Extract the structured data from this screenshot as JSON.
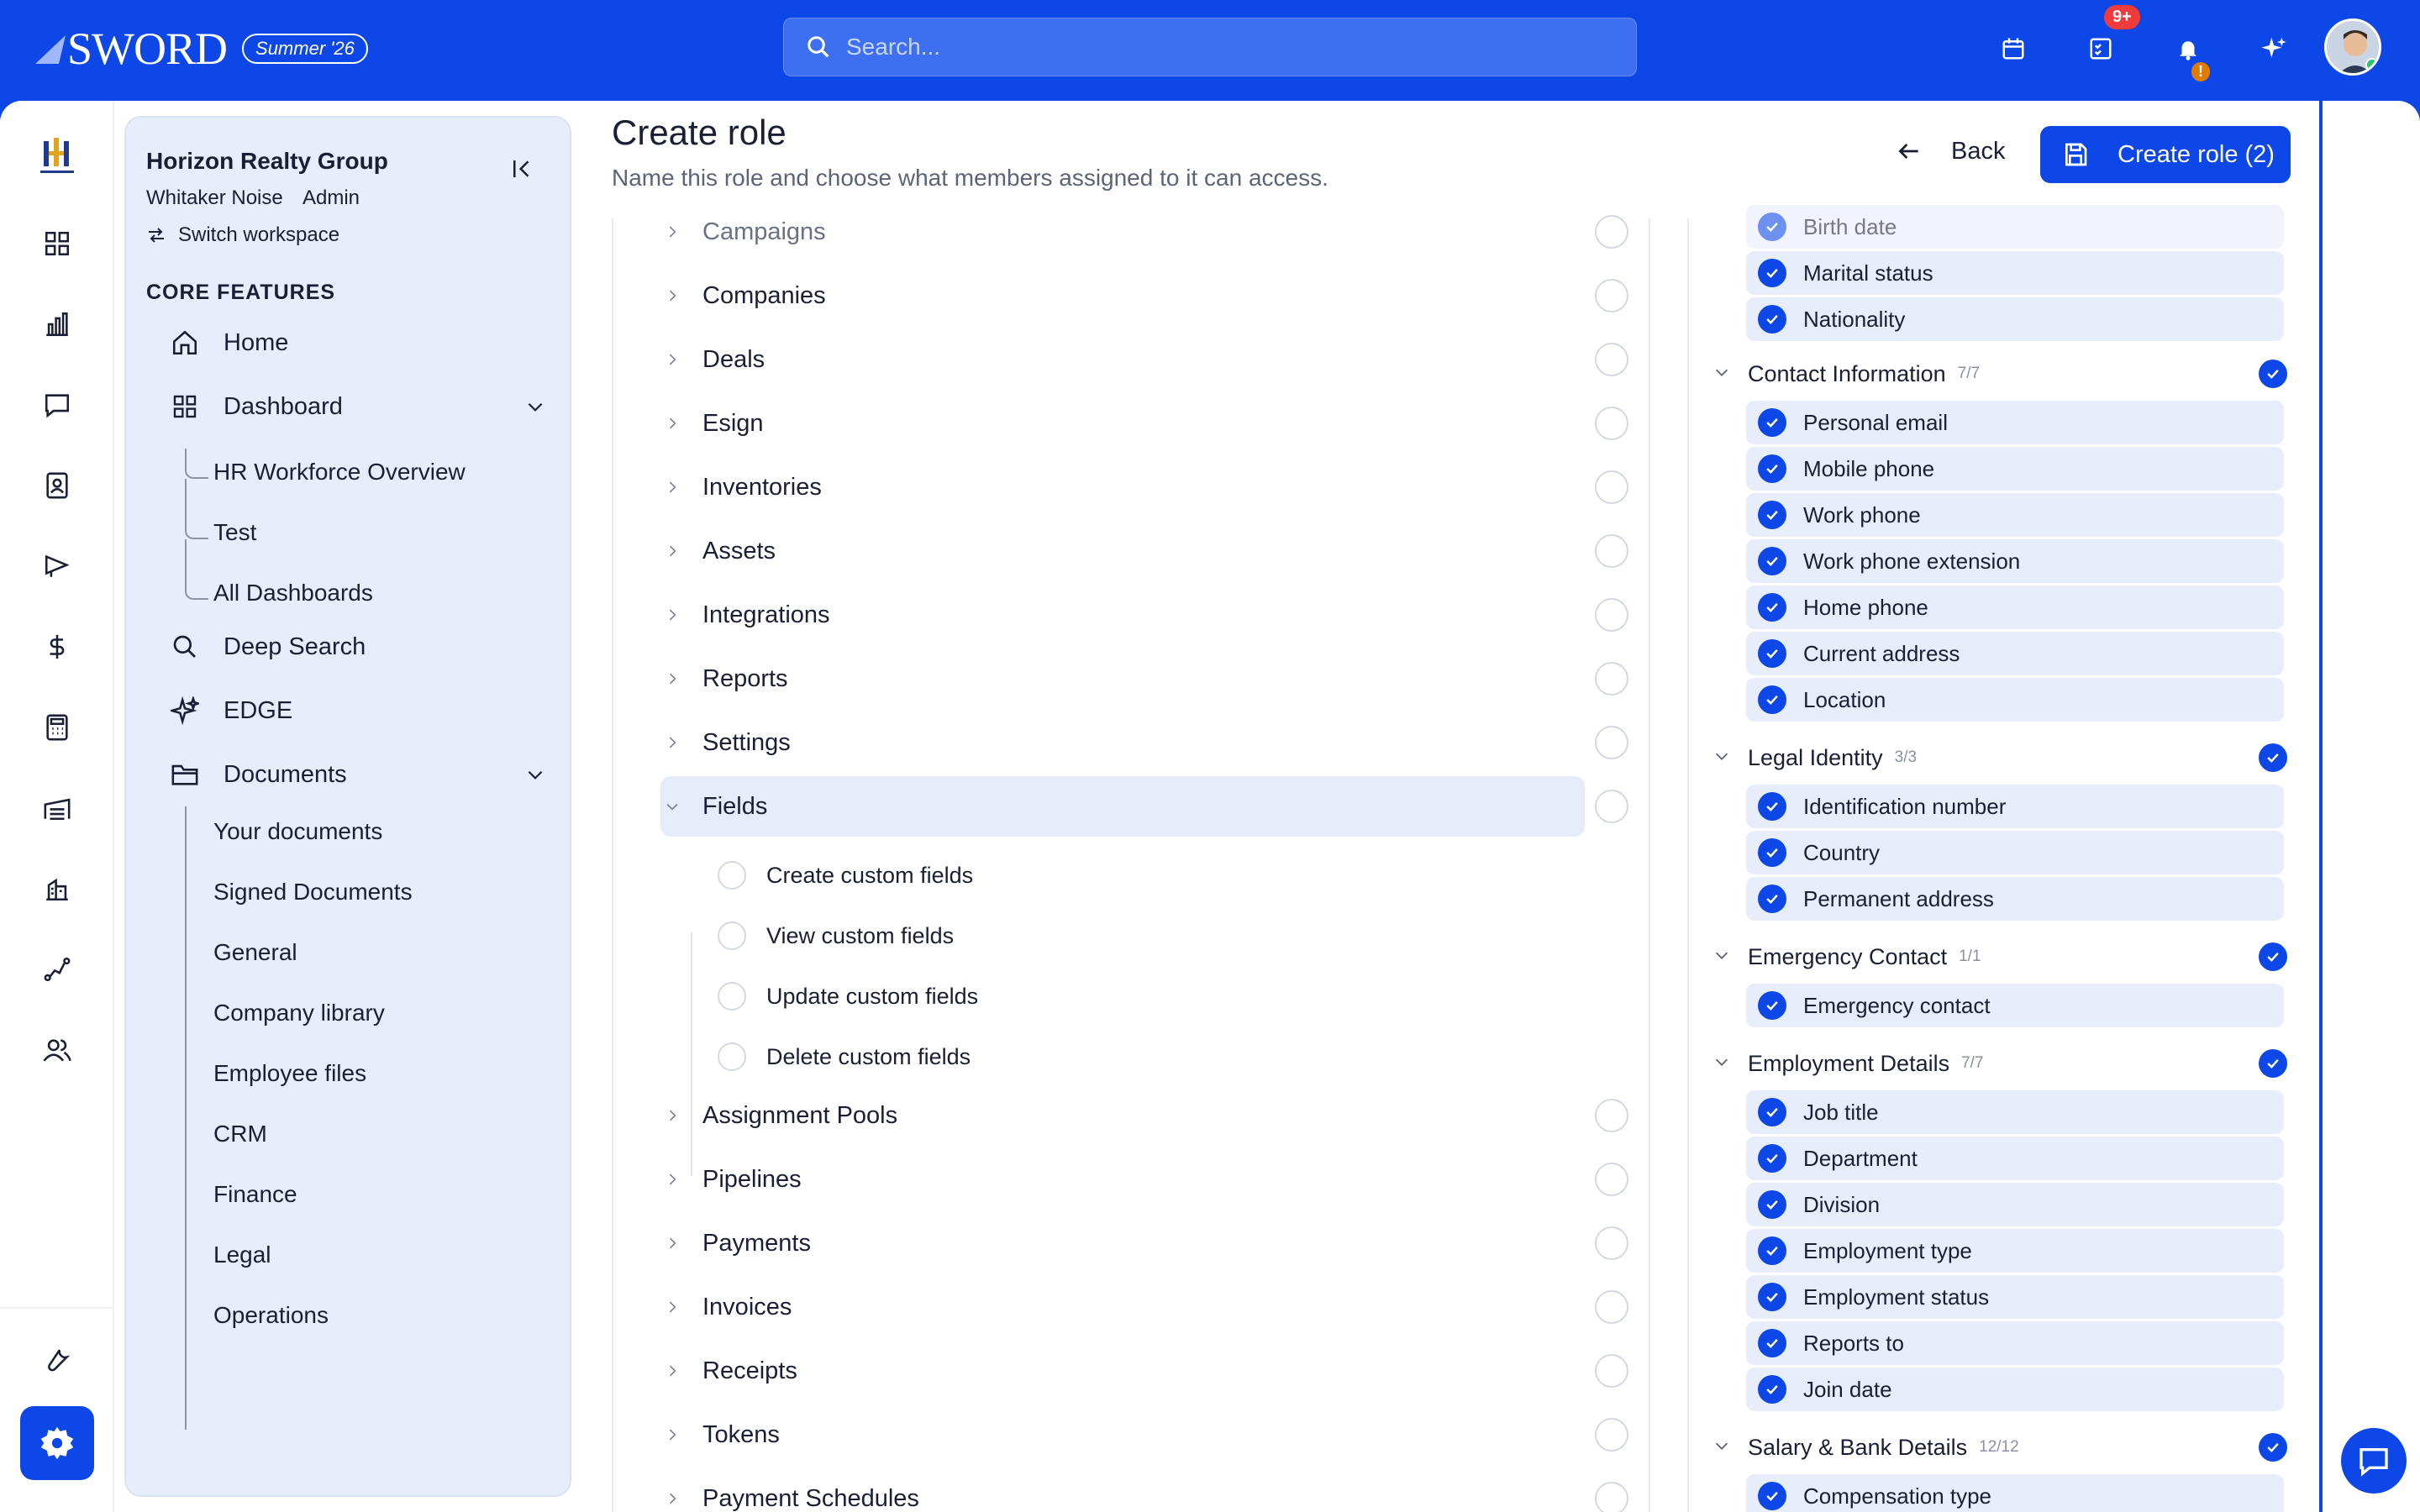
{
  "app": {
    "brand": "SWORD",
    "version_badge": "Summer '26"
  },
  "search": {
    "placeholder": "Search..."
  },
  "topbar": {
    "tasks_badge": "9+",
    "bell_badge": "!"
  },
  "workspace": {
    "name": "Horizon Realty Group",
    "user": "Whitaker Noise",
    "role": "Admin",
    "switch_label": "Switch workspace"
  },
  "sidebar": {
    "section_title": "CORE FEATURES",
    "items": [
      {
        "label": "Home",
        "icon": "home-icon"
      },
      {
        "label": "Dashboard",
        "icon": "grid-icon"
      },
      {
        "label": "Deep Search",
        "icon": "search-icon"
      },
      {
        "label": "EDGE",
        "icon": "sparkle-icon"
      },
      {
        "label": "Documents",
        "icon": "folder-icon"
      }
    ],
    "dashboard_sub": [
      "HR Workforce Overview",
      "Test",
      "All Dashboards"
    ],
    "documents_sub": [
      "Your documents",
      "Signed Documents",
      "General",
      "Company library",
      "Employee files",
      "CRM",
      "Finance",
      "Legal",
      "Operations"
    ]
  },
  "page": {
    "title": "Create role",
    "subtitle": "Name this role and choose what members assigned to it can access.",
    "back_label": "Back",
    "create_label": "Create role (2)"
  },
  "permissions": {
    "modules": [
      "Campaigns",
      "Companies",
      "Deals",
      "Esign",
      "Inventories",
      "Assets",
      "Integrations",
      "Reports",
      "Settings",
      "Fields",
      "Assignment Pools",
      "Pipelines",
      "Payments",
      "Invoices",
      "Receipts",
      "Tokens",
      "Payment Schedules"
    ],
    "fields_sub": [
      "Create custom fields",
      "View custom fields",
      "Update custom fields",
      "Delete custom fields"
    ]
  },
  "field_groups": {
    "top_items": [
      "Birth date",
      "Marital status",
      "Nationality"
    ],
    "groups": [
      {
        "title": "Contact Information",
        "count": "7/7",
        "items": [
          "Personal email",
          "Mobile phone",
          "Work phone",
          "Work phone extension",
          "Home phone",
          "Current address",
          "Location"
        ]
      },
      {
        "title": "Legal Identity",
        "count": "3/3",
        "items": [
          "Identification number",
          "Country",
          "Permanent address"
        ]
      },
      {
        "title": "Emergency Contact",
        "count": "1/1",
        "items": [
          "Emergency contact"
        ]
      },
      {
        "title": "Employment Details",
        "count": "7/7",
        "items": [
          "Job title",
          "Department",
          "Division",
          "Employment type",
          "Employment status",
          "Reports to",
          "Join date"
        ]
      },
      {
        "title": "Salary & Bank Details",
        "count": "12/12",
        "items": [
          "Compensation type"
        ]
      }
    ]
  },
  "colors": {
    "brand": "#0d47e8",
    "sidebar_bg": "#e8edfb"
  }
}
